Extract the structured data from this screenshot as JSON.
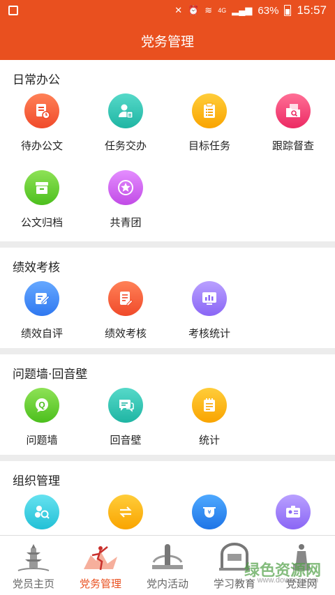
{
  "status_bar": {
    "battery": "63%",
    "time": "15:57",
    "network": "4G"
  },
  "header": {
    "title": "党务管理"
  },
  "sections": [
    {
      "title": "日常办公",
      "items": [
        {
          "label": "待办公文",
          "icon": "document-clock-icon",
          "color": "#f04a2a"
        },
        {
          "label": "任务交办",
          "icon": "person-assign-icon",
          "color": "#1fb5a3"
        },
        {
          "label": "目标任务",
          "icon": "clipboard-list-icon",
          "color": "#f9a400"
        },
        {
          "label": "跟踪督查",
          "icon": "folder-search-icon",
          "color": "#ec2a63"
        },
        {
          "label": "公文归档",
          "icon": "archive-box-icon",
          "color": "#4cbf1d"
        },
        {
          "label": "共青团",
          "icon": "star-badge-icon",
          "color": "#c14be6"
        }
      ]
    },
    {
      "title": "绩效考核",
      "items": [
        {
          "label": "绩效自评",
          "icon": "edit-note-icon",
          "color": "#2f78f0"
        },
        {
          "label": "绩效考核",
          "icon": "document-edit-icon",
          "color": "#f04a2a"
        },
        {
          "label": "考核统计",
          "icon": "bar-chart-icon",
          "color": "#8a66f5"
        }
      ]
    },
    {
      "title": "问题墙·回音壁",
      "items": [
        {
          "label": "问题墙",
          "icon": "question-bubble-icon",
          "color": "#4cbf1d"
        },
        {
          "label": "回音壁",
          "icon": "chat-bubble-icon",
          "color": "#1fb5a3"
        },
        {
          "label": "统计",
          "icon": "notepad-icon",
          "color": "#f9a400"
        }
      ]
    },
    {
      "title": "组织管理",
      "items": [
        {
          "label": "",
          "icon": "people-search-icon",
          "color": "#22c0d6"
        },
        {
          "label": "",
          "icon": "transfer-icon",
          "color": "#f9a400"
        },
        {
          "label": "",
          "icon": "wallet-icon",
          "color": "#1e74e6"
        },
        {
          "label": "",
          "icon": "id-card-icon",
          "color": "#8a66f5"
        }
      ]
    }
  ],
  "tabs": [
    {
      "label": "党员主页",
      "icon": "pagoda-icon"
    },
    {
      "label": "党务管理",
      "icon": "dancer-icon",
      "active": true
    },
    {
      "label": "党内活动",
      "icon": "monument-icon"
    },
    {
      "label": "学习教育",
      "icon": "gate-icon"
    },
    {
      "label": "党建网",
      "icon": "statue-icon"
    }
  ],
  "watermark": {
    "text": "绿色资源网",
    "url": "www.downcc.com"
  }
}
